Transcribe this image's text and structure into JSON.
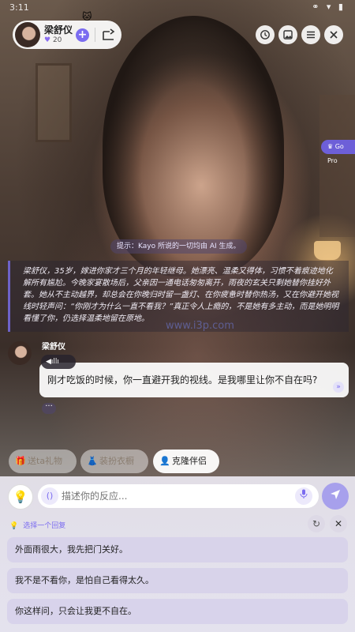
{
  "status_bar": {
    "time": "3:11",
    "icons": "⚭ ▾ ▮"
  },
  "header": {
    "name": "梁舒仪",
    "likes": "20",
    "follow_icon": "+",
    "share_icon": "share-icon",
    "history_icon": "history-icon",
    "gallery_icon": "gallery-icon",
    "menu_icon": "menu-icon",
    "close_icon": "close-icon",
    "deco": "🐱"
  },
  "go_pro": {
    "label": "Go Pro"
  },
  "hint": {
    "text": "提示：Kayo 所说的一切均由 AI 生成。"
  },
  "narration": {
    "text": "梁舒仪，35岁，嫁进你家才三个月的年轻继母。她漂亮、温柔又得体，习惯不着痕迹地化解所有尴尬。今晚家宴散场后，父亲因一通电话匆匆离开，雨夜的玄关只剩她替你挂好外套。她从不主动越界，却总会在你晚归时留一盏灯、在你疲惫时替你热汤，又在你避开她视线时轻声问：“你刚才为什么一直不看我？”真正令人上瘾的，不是她有多主动，而是她明明看懂了你，仍选择温柔地留在原地。"
  },
  "watermark": "www.i3p.com",
  "message": {
    "sender": "梁舒仪",
    "voice_label": "◀ıllı",
    "text": "刚才吃饭的时候，你一直避开我的视线。是我哪里让你不自在吗?",
    "more": "»",
    "menu": "···"
  },
  "chips": {
    "gift": "送ta礼物",
    "outfit": "装扮衣橱",
    "companion": "克隆伴侣"
  },
  "input": {
    "placeholder": "描述你的反应...",
    "paren": "()",
    "bulb": "💡"
  },
  "replies": {
    "title": "选择一个回复",
    "options": [
      "外面雨很大，我先把门关好。",
      "我不是不看你，是怕自己看得太久。",
      "你这样问，只会让我更不自在。"
    ]
  },
  "colors": {
    "accent": "#7b6cf0",
    "send": "#a7a0ec"
  }
}
